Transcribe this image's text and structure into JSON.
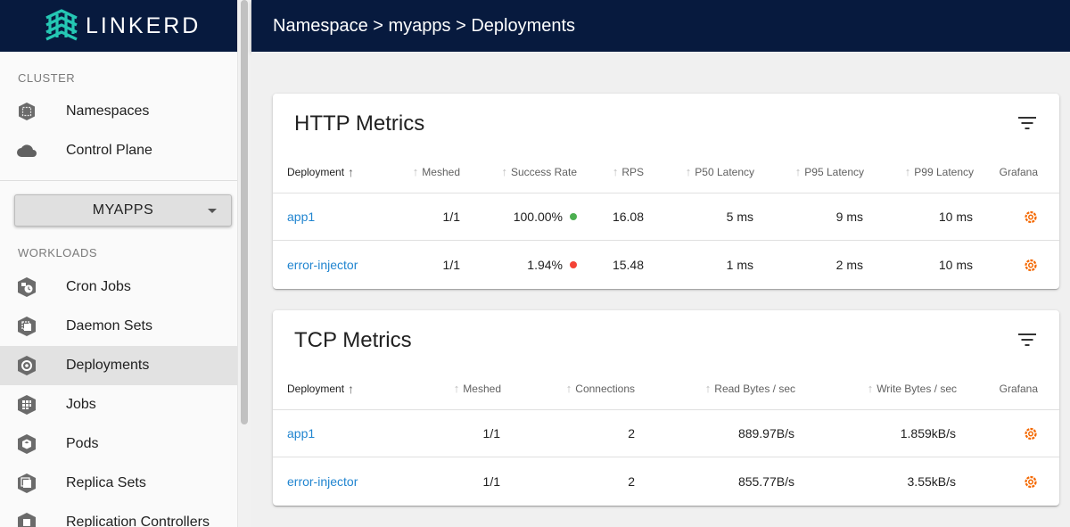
{
  "brand": {
    "name": "LINKERD",
    "bg": "#071a3e",
    "accent": "#25c7b4"
  },
  "sidebar": {
    "cluster_label": "CLUSTER",
    "cluster_items": [
      {
        "label": "Namespaces",
        "icon": "namespace-icon"
      },
      {
        "label": "Control Plane",
        "icon": "cloud-icon"
      }
    ],
    "namespace_select": "MYAPPS",
    "workloads_label": "WORKLOADS",
    "workload_items": [
      {
        "label": "Cron Jobs",
        "icon": "cronjob-icon"
      },
      {
        "label": "Daemon Sets",
        "icon": "daemonset-icon"
      },
      {
        "label": "Deployments",
        "icon": "deployment-icon",
        "active": true
      },
      {
        "label": "Jobs",
        "icon": "job-icon"
      },
      {
        "label": "Pods",
        "icon": "pod-icon"
      },
      {
        "label": "Replica Sets",
        "icon": "replicaset-icon"
      },
      {
        "label": "Replication Controllers",
        "icon": "replicationcontroller-icon"
      }
    ]
  },
  "header": {
    "breadcrumb": "Namespace > myapps > Deployments"
  },
  "http": {
    "title": "HTTP Metrics",
    "columns": [
      "Deployment",
      "Meshed",
      "Success Rate",
      "RPS",
      "P50 Latency",
      "P95 Latency",
      "P99 Latency",
      "Grafana"
    ],
    "rows": [
      {
        "deployment": "app1",
        "meshed": "1/1",
        "success_rate": "100.00%",
        "status_color": "#4caf50",
        "rps": "16.08",
        "p50": "5 ms",
        "p95": "9 ms",
        "p99": "10 ms"
      },
      {
        "deployment": "error-injector",
        "meshed": "1/1",
        "success_rate": "1.94%",
        "status_color": "#f44336",
        "rps": "15.48",
        "p50": "1 ms",
        "p95": "2 ms",
        "p99": "10 ms"
      }
    ]
  },
  "tcp": {
    "title": "TCP Metrics",
    "columns": [
      "Deployment",
      "Meshed",
      "Connections",
      "Read Bytes / sec",
      "Write Bytes / sec",
      "Grafana"
    ],
    "rows": [
      {
        "deployment": "app1",
        "meshed": "1/1",
        "connections": "2",
        "read": "889.97B/s",
        "write": "1.859kB/s"
      },
      {
        "deployment": "error-injector",
        "meshed": "1/1",
        "connections": "2",
        "read": "855.77B/s",
        "write": "3.55kB/s"
      }
    ]
  },
  "colors": {
    "link": "#2185d0",
    "grafana": "#f46800"
  }
}
